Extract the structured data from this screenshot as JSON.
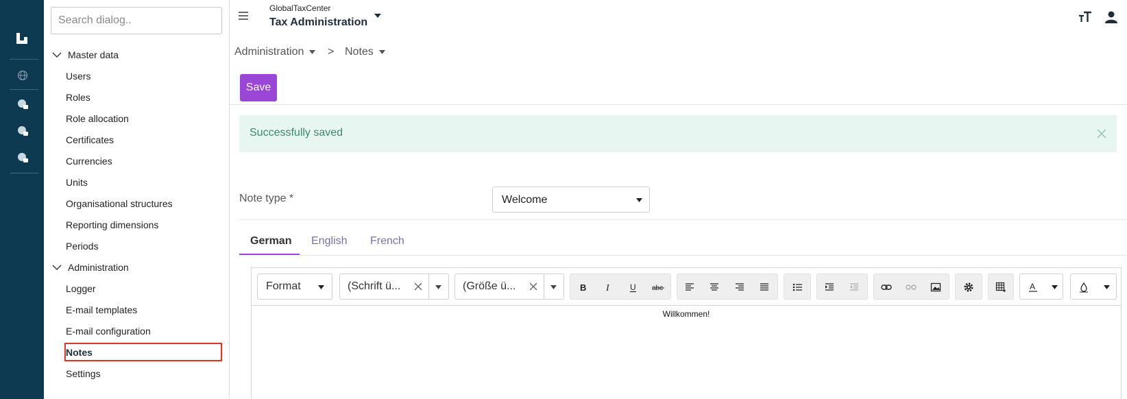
{
  "app": {
    "subtitle": "GlobalTaxCenter",
    "title": "Tax Administration"
  },
  "sidebar": {
    "search_placeholder": "Search dialog..",
    "groups": [
      {
        "label": "Master data",
        "items": [
          "Users",
          "Roles",
          "Role allocation",
          "Certificates",
          "Currencies",
          "Units",
          "Organisational structures",
          "Reporting dimensions",
          "Periods"
        ]
      },
      {
        "label": "Administration",
        "items": [
          "Logger",
          "E-mail templates",
          "E-mail configuration",
          "Notes",
          "Settings"
        ]
      }
    ],
    "active_item": "Notes"
  },
  "breadcrumb": {
    "items": [
      "Administration",
      "Notes"
    ],
    "separator": ">"
  },
  "toolbar": {
    "save_label": "Save"
  },
  "alert": {
    "message": "Successfully saved"
  },
  "form": {
    "note_type_label": "Note type *",
    "note_type_value": "Welcome"
  },
  "tabs": [
    {
      "label": "German",
      "active": true
    },
    {
      "label": "English",
      "active": false
    },
    {
      "label": "French",
      "active": false
    }
  ],
  "editor": {
    "format_label": "Format",
    "font_label": "(Schrift ü...",
    "size_label": "(Größe ü...",
    "content": "Willkommen!",
    "icons": [
      "bold-icon",
      "italic-icon",
      "underline-icon",
      "strikethrough-icon",
      "align-left-icon",
      "align-center-icon",
      "align-right-icon",
      "align-justify-icon",
      "bulleted-list-icon",
      "indent-icon",
      "outdent-icon",
      "link-icon",
      "unlink-icon",
      "image-icon",
      "settings-icon",
      "table-icon",
      "text-color-icon",
      "background-color-icon"
    ]
  },
  "colors": {
    "rail": "#0d3a50",
    "accent": "#9a46d6",
    "alert_bg": "#e8f6f1",
    "alert_text": "#3c8a6a",
    "highlight_box": "#d43a2c"
  }
}
